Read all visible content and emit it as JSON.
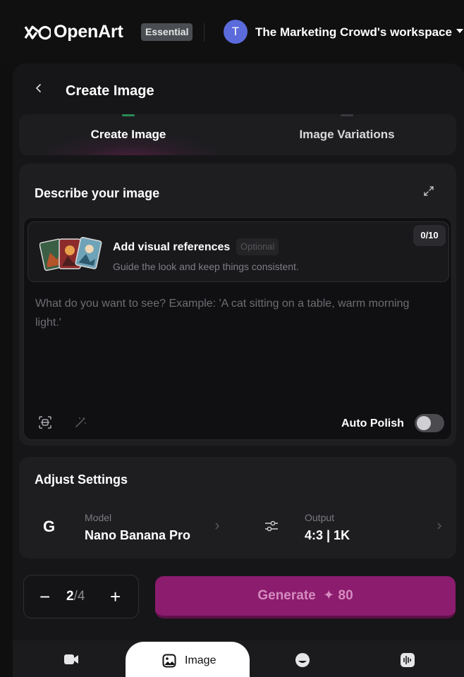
{
  "topbar": {
    "brand": "OpenArt",
    "plan_badge": "Essential",
    "avatar_initial": "T",
    "workspace": "The Marketing Crowd's workspace"
  },
  "header": {
    "title": "Create Image"
  },
  "tabs": [
    {
      "label": "Create Image",
      "active": true
    },
    {
      "label": "Image Variations",
      "active": false
    }
  ],
  "describe": {
    "title": "Describe your image",
    "references": {
      "title": "Add visual references",
      "optional": "Optional",
      "subtitle": "Guide the look and keep things consistent.",
      "count": "0/10"
    },
    "prompt_placeholder": "What do you want to see? Example: 'A cat sitting on a table, warm morning light.'",
    "auto_polish_label": "Auto Polish",
    "auto_polish_on": false
  },
  "settings": {
    "title": "Adjust Settings",
    "model": {
      "icon_letter": "G",
      "label": "Model",
      "value": "Nano Banana Pro"
    },
    "output": {
      "label": "Output",
      "value": "4:3 | 1K"
    }
  },
  "batch": {
    "minus": "−",
    "current": "2",
    "separator": "/",
    "max": "4",
    "plus": "+"
  },
  "generate": {
    "label": "Generate",
    "credits": "80"
  },
  "bottom_nav": [
    {
      "icon": "video-icon",
      "label": ""
    },
    {
      "icon": "image-icon",
      "label": "Image",
      "active": true
    },
    {
      "icon": "face-icon",
      "label": ""
    },
    {
      "icon": "audio-icon",
      "label": ""
    }
  ],
  "colors": {
    "background": "#0f0f10",
    "panel": "#161618",
    "card": "#1e1e21",
    "generate": "#8c1c6e",
    "avatar": "#5b6bdb"
  }
}
